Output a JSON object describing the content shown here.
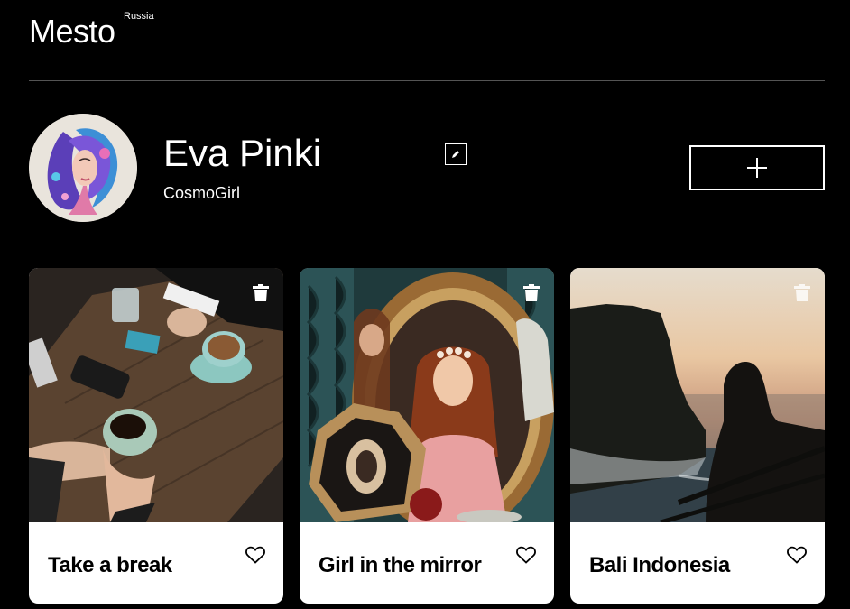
{
  "header": {
    "logo": "Mesto",
    "logo_sub": "Russia"
  },
  "profile": {
    "name": "Eva Pinki",
    "about": "CosmoGirl",
    "edit_icon": "pencil-icon",
    "add_icon": "plus-icon"
  },
  "cards": [
    {
      "title": "Take a break",
      "image": "people-with-coffee-cups-on-wooden-table"
    },
    {
      "title": "Girl in the mirror",
      "image": "woman-reflected-in-ornate-mirror"
    },
    {
      "title": "Bali Indonesia",
      "image": "silhouette-at-sea-cliff-sunset"
    }
  ],
  "colors": {
    "background": "#000000",
    "card_bg": "#ffffff",
    "divider": "#545454"
  }
}
